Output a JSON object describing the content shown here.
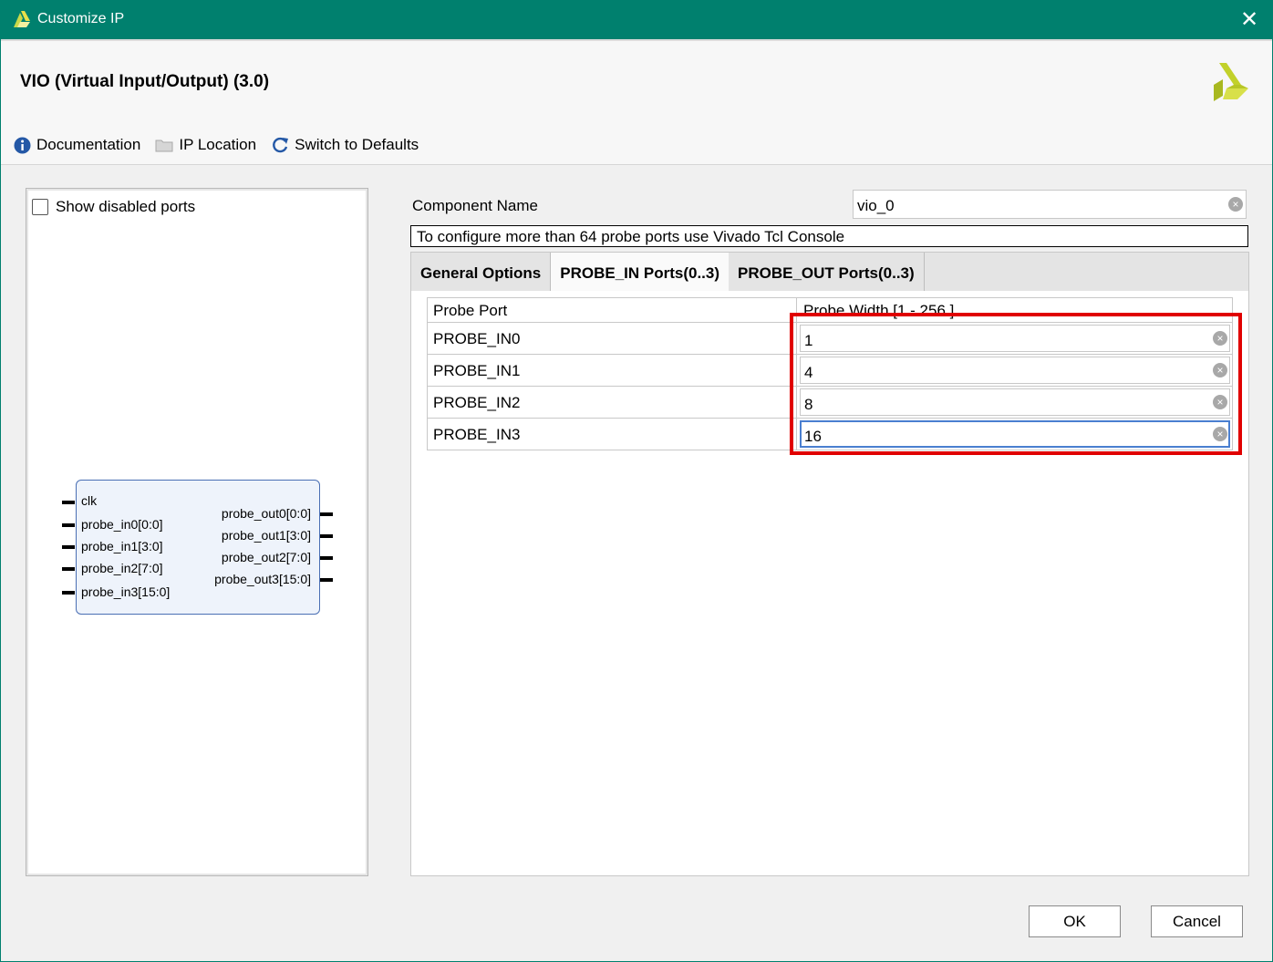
{
  "window": {
    "title": "Customize IP",
    "close_glyph": "✕"
  },
  "header": {
    "ip_title": "VIO (Virtual Input/Output) (3.0)"
  },
  "toolbar": {
    "documentation": "Documentation",
    "ip_location": "IP Location",
    "switch_defaults": "Switch to Defaults"
  },
  "left": {
    "show_disabled_ports": "Show disabled ports",
    "block": {
      "inputs": [
        "clk",
        "probe_in0[0:0]",
        "probe_in1[3:0]",
        "probe_in2[7:0]",
        "probe_in3[15:0]"
      ],
      "outputs": [
        "probe_out0[0:0]",
        "probe_out1[3:0]",
        "probe_out2[7:0]",
        "probe_out3[15:0]"
      ]
    }
  },
  "right": {
    "component_name_label": "Component Name",
    "component_name_value": "vio_0",
    "info": "To configure more than 64 probe ports use Vivado Tcl Console",
    "tabs": [
      "General Options",
      "PROBE_IN Ports(0..3)",
      "PROBE_OUT Ports(0..3)"
    ],
    "active_tab": "PROBE_IN Ports(0..3)",
    "table": {
      "headers": [
        "Probe Port",
        "Probe Width [1 - 256 ]"
      ],
      "rows": [
        {
          "port": "PROBE_IN0",
          "width": "1"
        },
        {
          "port": "PROBE_IN1",
          "width": "4"
        },
        {
          "port": "PROBE_IN2",
          "width": "8"
        },
        {
          "port": "PROBE_IN3",
          "width": "16"
        }
      ]
    }
  },
  "buttons": {
    "ok": "OK",
    "cancel": "Cancel"
  },
  "colors": {
    "titlebar": "#00806e",
    "highlight": "#e00000",
    "block_border": "#4a6fb4"
  }
}
